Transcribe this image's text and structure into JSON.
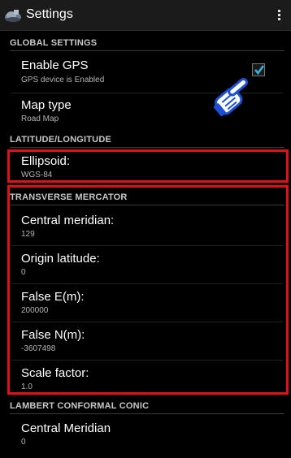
{
  "app": {
    "title": "Settings",
    "icon": "app-icon",
    "menu_icon": "overflow-menu-icon"
  },
  "sections": {
    "global": "GLOBAL SETTINGS",
    "latlon": "LATITUDE/LONGITUDE",
    "tm": "TRANSVERSE MERCATOR",
    "lcc": "LAMBERT CONFORMAL CONIC"
  },
  "prefs": {
    "gps": {
      "title": "Enable GPS",
      "summary": "GPS device is Enabled",
      "checked": true
    },
    "map_type": {
      "title": "Map type",
      "summary": "Road Map"
    },
    "ellipsoid": {
      "title": "Ellipsoid:",
      "summary": "WGS-84"
    },
    "central_meridian": {
      "title": "Central meridian:",
      "summary": "129"
    },
    "origin_latitude": {
      "title": "Origin latitude:",
      "summary": "0"
    },
    "false_e": {
      "title": "False E(m):",
      "summary": "200000"
    },
    "false_n": {
      "title": "False N(m):",
      "summary": "-3607498"
    },
    "scale_factor": {
      "title": "Scale factor:",
      "summary": "1.0"
    },
    "lcc_central_meridian": {
      "title": "Central Meridian",
      "summary": "0"
    }
  },
  "colors": {
    "highlight": "#e0111b",
    "checkbox_accent": "#33b5e5"
  }
}
